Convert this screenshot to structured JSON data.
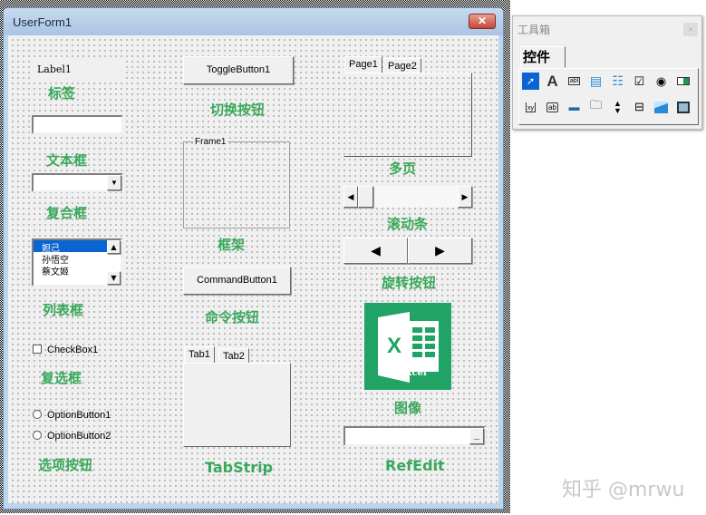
{
  "window": {
    "title": "UserForm1",
    "close": "✕"
  },
  "controls": {
    "label": {
      "text": "Label1",
      "caption": "标签"
    },
    "textbox": {
      "value": "",
      "caption": "文本框"
    },
    "combobox": {
      "value": "",
      "caption": "复合框"
    },
    "listbox": {
      "items": [
        "妲己",
        "孙悟空",
        "蔡文姬"
      ],
      "selected": "妲己",
      "caption": "列表框"
    },
    "checkbox": {
      "text": "CheckBox1",
      "checked": false,
      "caption": "复选框"
    },
    "option1": {
      "text": "OptionButton1"
    },
    "option2": {
      "text": "OptionButton2"
    },
    "options_caption": "选项按钮",
    "toggle": {
      "text": "ToggleButton1",
      "caption": "切换按钮"
    },
    "frame": {
      "text": "Frame1",
      "caption": "框架"
    },
    "command": {
      "text": "CommandButton1",
      "caption": "命令按钮"
    },
    "tabstrip": {
      "tabs": [
        "Tab1",
        "Tab2"
      ],
      "caption": "TabStrip"
    },
    "multipage": {
      "tabs": [
        "Page1",
        "Page2"
      ],
      "caption": "多页"
    },
    "scrollbar": {
      "caption": "滚动条"
    },
    "spin": {
      "caption": "旋转按钮"
    },
    "image": {
      "logo_text": "AiExcel",
      "caption": "图像"
    },
    "refedit": {
      "value": "",
      "caption": "RefEdit"
    }
  },
  "toolbox": {
    "title": "工具箱",
    "tab": "控件",
    "tools": [
      "select-objects",
      "label",
      "textbox",
      "combobox",
      "listbox",
      "checkbox",
      "optionbutton",
      "togglebutton",
      "frame",
      "commandbutton",
      "tabstrip",
      "multipage",
      "scrollbar",
      "spinbutton",
      "image",
      "refedit"
    ]
  },
  "watermark": "知乎 @mrwu",
  "colors": {
    "caption": "#3aa85a",
    "excel": "#21a366",
    "selection": "#0a64d2"
  }
}
